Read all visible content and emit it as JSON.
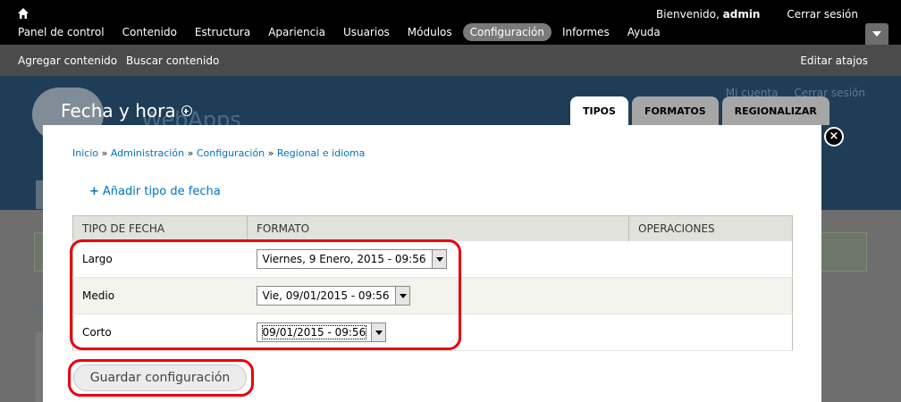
{
  "toolbar": {
    "welcome_prefix": "Bienvenido,",
    "username": "admin",
    "logout": "Cerrar sesión",
    "menu": [
      {
        "label": "Panel de control"
      },
      {
        "label": "Contenido"
      },
      {
        "label": "Estructura"
      },
      {
        "label": "Apariencia"
      },
      {
        "label": "Usuarios"
      },
      {
        "label": "Módulos"
      },
      {
        "label": "Configuración",
        "active": true
      },
      {
        "label": "Informes"
      },
      {
        "label": "Ayuda"
      }
    ]
  },
  "shortcuts": {
    "items": [
      "Agregar contenido",
      "Buscar contenido"
    ],
    "edit": "Editar atajos"
  },
  "background_site": {
    "site_name": "WebApps",
    "secondary_menu": [
      "Mi cuenta",
      "Cerrar sesión"
    ],
    "link_fragment": "In"
  },
  "overlay": {
    "title": "Fecha y hora",
    "tabs": [
      {
        "label": "TIPOS",
        "active": true
      },
      {
        "label": "FORMATOS"
      },
      {
        "label": "REGIONALIZAR"
      }
    ],
    "close": "×"
  },
  "breadcrumb": {
    "items": [
      "Inicio",
      "Administración",
      "Configuración",
      "Regional e idioma"
    ],
    "separator": "»"
  },
  "add_date_type": {
    "icon": "+",
    "label": "Añadir tipo de fecha"
  },
  "table": {
    "headers": [
      "TIPO DE FECHA",
      "FORMATO",
      "OPERACIONES"
    ],
    "rows": [
      {
        "type": "Largo",
        "format": "Viernes, 9 Enero, 2015 - 09:56"
      },
      {
        "type": "Medio",
        "format": "Vie, 09/01/2015 - 09:56"
      },
      {
        "type": "Corto",
        "format": "09/01/2015 - 09:56"
      }
    ]
  },
  "save_button": "Guardar configuración",
  "colors": {
    "link": "#0074bd",
    "highlight": "#e8000d",
    "toolbar": "#000000"
  }
}
